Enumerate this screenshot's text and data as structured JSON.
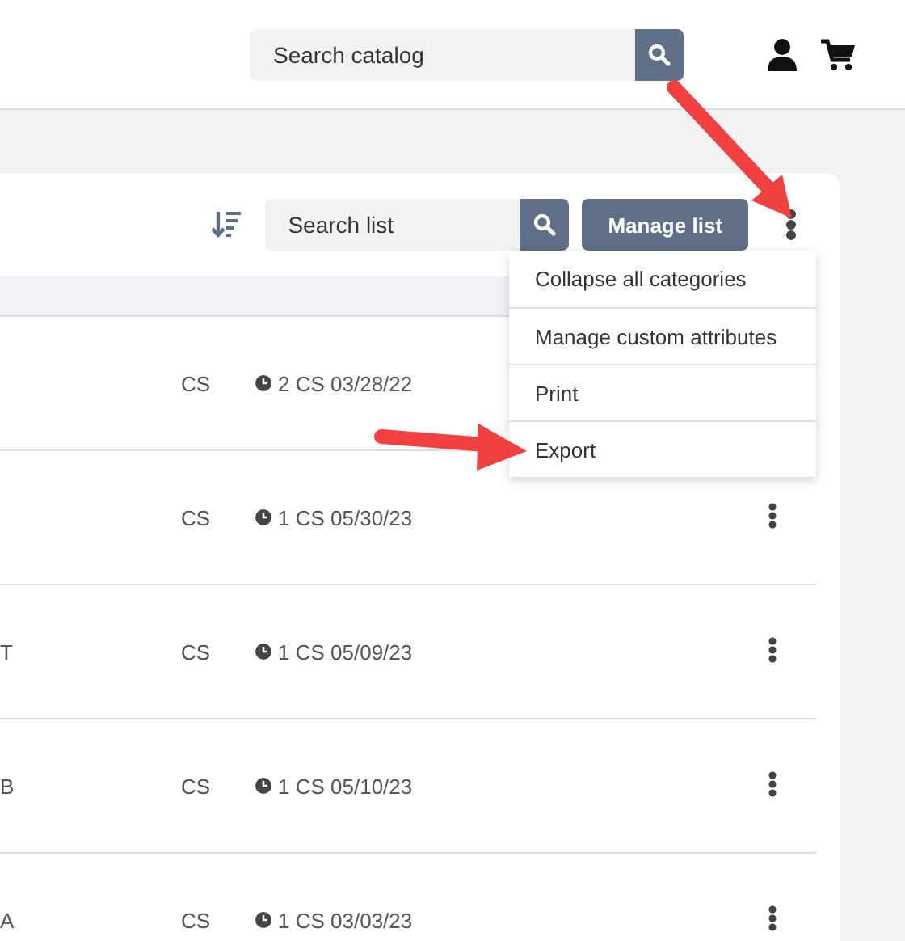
{
  "header": {
    "search": {
      "placeholder": "Search catalog"
    }
  },
  "toolbar": {
    "search": {
      "placeholder": "Search list"
    },
    "manage_button": "Manage list"
  },
  "menu": {
    "items": [
      {
        "label": "Collapse all categories"
      },
      {
        "label": "Manage custom attributes"
      },
      {
        "label": "Print"
      },
      {
        "label": "Export"
      }
    ]
  },
  "rows": [
    {
      "unit": "CS",
      "history": "2 CS 03/28/22",
      "has_menu": false
    },
    {
      "unit": "CS",
      "history": "1 CS 05/30/23",
      "has_menu": true
    },
    {
      "column_1": "T",
      "unit": "CS",
      "history": "1 CS 05/09/23",
      "has_menu": true
    },
    {
      "column_1": "B",
      "unit": "CS",
      "history": "1 CS 05/10/23",
      "has_menu": true
    },
    {
      "column_1": "A",
      "unit": "CS",
      "history": "1 CS 03/03/23",
      "has_menu": true
    }
  ]
}
